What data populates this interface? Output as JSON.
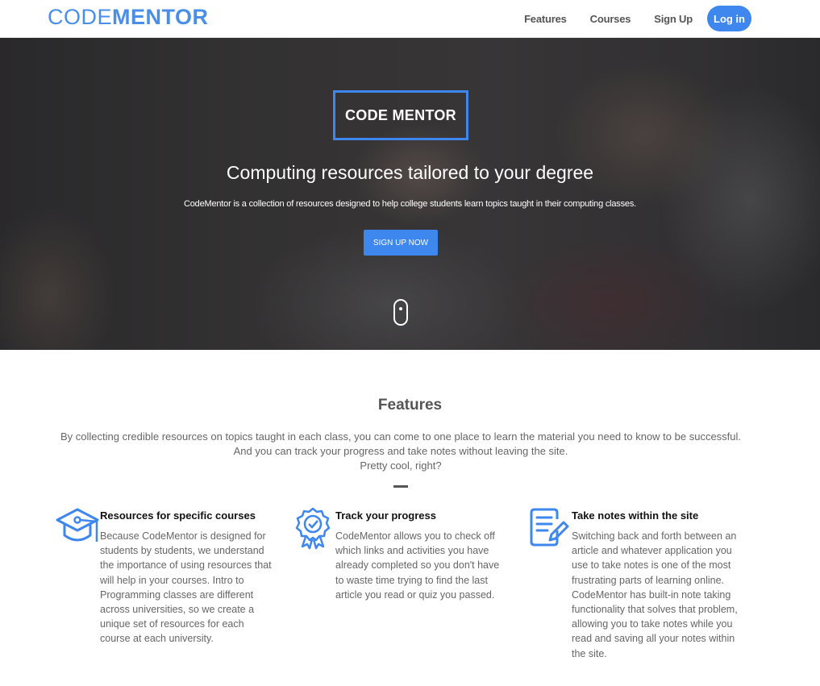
{
  "nav": {
    "brand_part1": "CODE",
    "brand_part2": "MENTOR",
    "links": [
      "Features",
      "Courses",
      "Sign Up"
    ],
    "login_label": "Log in"
  },
  "hero": {
    "box_label": "CODE MENTOR",
    "title": "Computing resources tailored to your degree",
    "subtitle": "CodeMentor is a collection of resources designed to help college students learn topics taught in their computing classes.",
    "cta_label": "SIGN UP NOW"
  },
  "features": {
    "title": "Features",
    "description_line1": "By collecting credible resources on topics taught in each class, you can come to one place to learn the material you need to know to be successful. And you can track your progress and take notes without leaving the site.",
    "description_line2": "Pretty cool, right?",
    "items": [
      {
        "icon": "graduation-cap-icon",
        "title": "Resources for specific courses",
        "text": "Because CodeMentor is designed for students by students, we understand the importance of using resources that will help in your courses. Intro to Programming classes are different across universities, so we create a unique set of resources for each course at each university."
      },
      {
        "icon": "award-badge-icon",
        "title": "Track your progress",
        "text": "CodeMentor allows you to check off which links and activities you have already completed so you don't have to waste time trying to find the last article you read or quiz you passed."
      },
      {
        "icon": "notes-edit-icon",
        "title": "Take notes within the site",
        "text": "Switching back and forth between an article and whatever application you use to take notes is one of the most frustrating parts of learning online. CodeMentor has built-in note taking functionality that solves that problem, allowing you to take notes while you read and saving all your notes within the site."
      }
    ]
  },
  "colors": {
    "accent": "#3d87ee",
    "brand": "#4a8fe7"
  }
}
